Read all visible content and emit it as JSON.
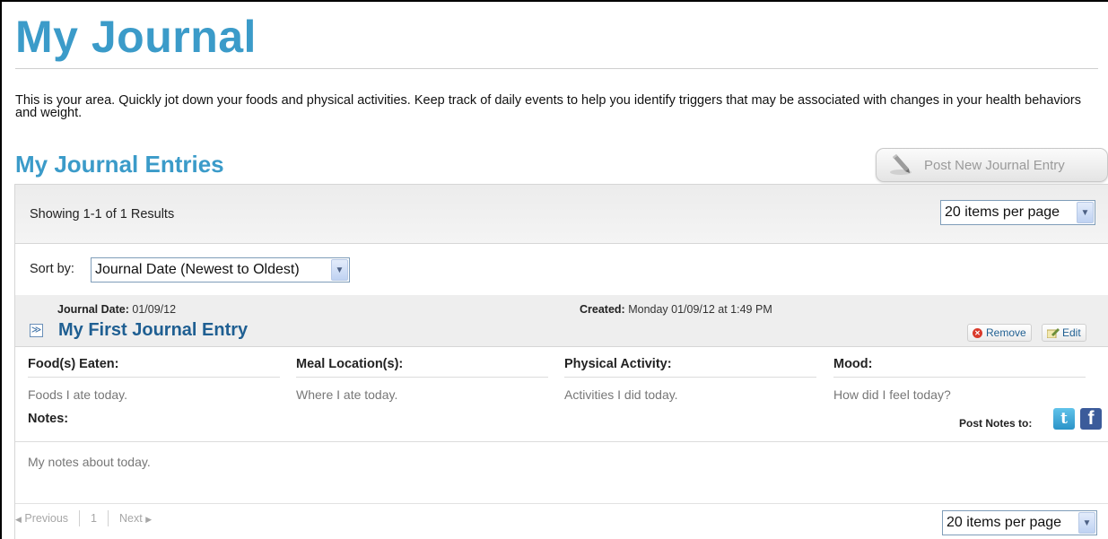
{
  "page": {
    "title": "My Journal",
    "intro": "This is your area. Quickly jot down your foods and physical activities. Keep track of daily events to help you identify triggers that may be associated with changes in your health behaviors and weight."
  },
  "entries_section": {
    "title": "My Journal Entries",
    "post_button_label": "Post New Journal Entry",
    "results_text": "Showing 1-1 of 1 Results",
    "items_per_page": "20 items per page",
    "sort_label": "Sort by:",
    "sort_value": "Journal Date (Newest to Oldest)"
  },
  "entry": {
    "journal_date_label": "Journal Date:",
    "journal_date": "01/09/12",
    "created_label": "Created:",
    "created_value": "Monday 01/09/12 at 1:49 PM",
    "title": "My First Journal Entry",
    "remove_label": "Remove",
    "edit_label": "Edit",
    "columns": [
      {
        "header": "Food(s) Eaten:",
        "value": "Foods I ate today."
      },
      {
        "header": "Meal Location(s):",
        "value": "Where I ate today."
      },
      {
        "header": "Physical Activity:",
        "value": "Activities I did today."
      },
      {
        "header": "Mood:",
        "value": "How did I feel today?"
      }
    ],
    "notes_label": "Notes:",
    "notes_value": "My notes about today.",
    "post_notes_label": "Post Notes to:",
    "social_icons": [
      "twitter-icon",
      "facebook-icon"
    ]
  },
  "pagination": {
    "previous_label": "Previous",
    "current_page": "1",
    "next_label": "Next",
    "items_per_page": "20 items per page"
  },
  "colors": {
    "heading_blue": "#3b9bc9",
    "entry_title_blue": "#1f5f92",
    "remove_red": "#d93a2b",
    "facebook_blue": "#3b5b9a",
    "twitter_blue": "#2b93c8"
  }
}
